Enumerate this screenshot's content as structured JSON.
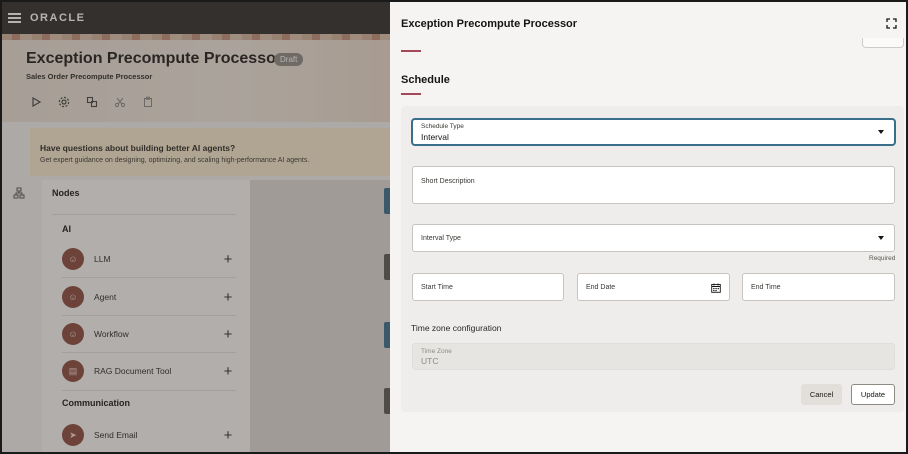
{
  "app": {
    "logo": "ORACLE"
  },
  "header": {
    "title": "Exception Precompute Processor",
    "status_badge": "Draft",
    "subtitle": "Sales Order Precompute Processor"
  },
  "banner": {
    "title": "Have questions about building better AI agents?",
    "text": "Get expert guidance on designing, optimizing, and scaling high-performance AI agents."
  },
  "nodes_panel": {
    "title": "Nodes",
    "sections": [
      {
        "label": "AI",
        "items": [
          {
            "label": "LLM",
            "icon": "llm-icon"
          },
          {
            "label": "Agent",
            "icon": "agent-icon"
          },
          {
            "label": "Workflow",
            "icon": "workflow-icon"
          },
          {
            "label": "RAG Document Tool",
            "icon": "document-icon"
          }
        ]
      },
      {
        "label": "Communication",
        "items": [
          {
            "label": "Send Email",
            "icon": "send-icon"
          }
        ]
      }
    ],
    "add_glyph": "+"
  },
  "drawer": {
    "title": "Exception Precompute Processor",
    "section_heading": "Schedule",
    "form": {
      "schedule_type": {
        "label": "Schedule Type",
        "value": "Interval"
      },
      "short_description": {
        "label": "Short Description",
        "value": ""
      },
      "interval_type": {
        "label": "Interval Type",
        "value": "",
        "required_text": "Required"
      },
      "start_time": {
        "label": "Start Time"
      },
      "end_date": {
        "label": "End Date"
      },
      "end_time": {
        "label": "End Time"
      },
      "timezone_heading": "Time zone configuration",
      "time_zone": {
        "label": "Time Zone",
        "value": "UTC"
      }
    },
    "buttons": {
      "cancel": "Cancel",
      "update": "Update"
    }
  },
  "colors": {
    "accent": "#a4495a",
    "focus": "#3a6f8c",
    "node_icon_bg": "#8a4a3e",
    "topbar": "#2f2c2a"
  }
}
